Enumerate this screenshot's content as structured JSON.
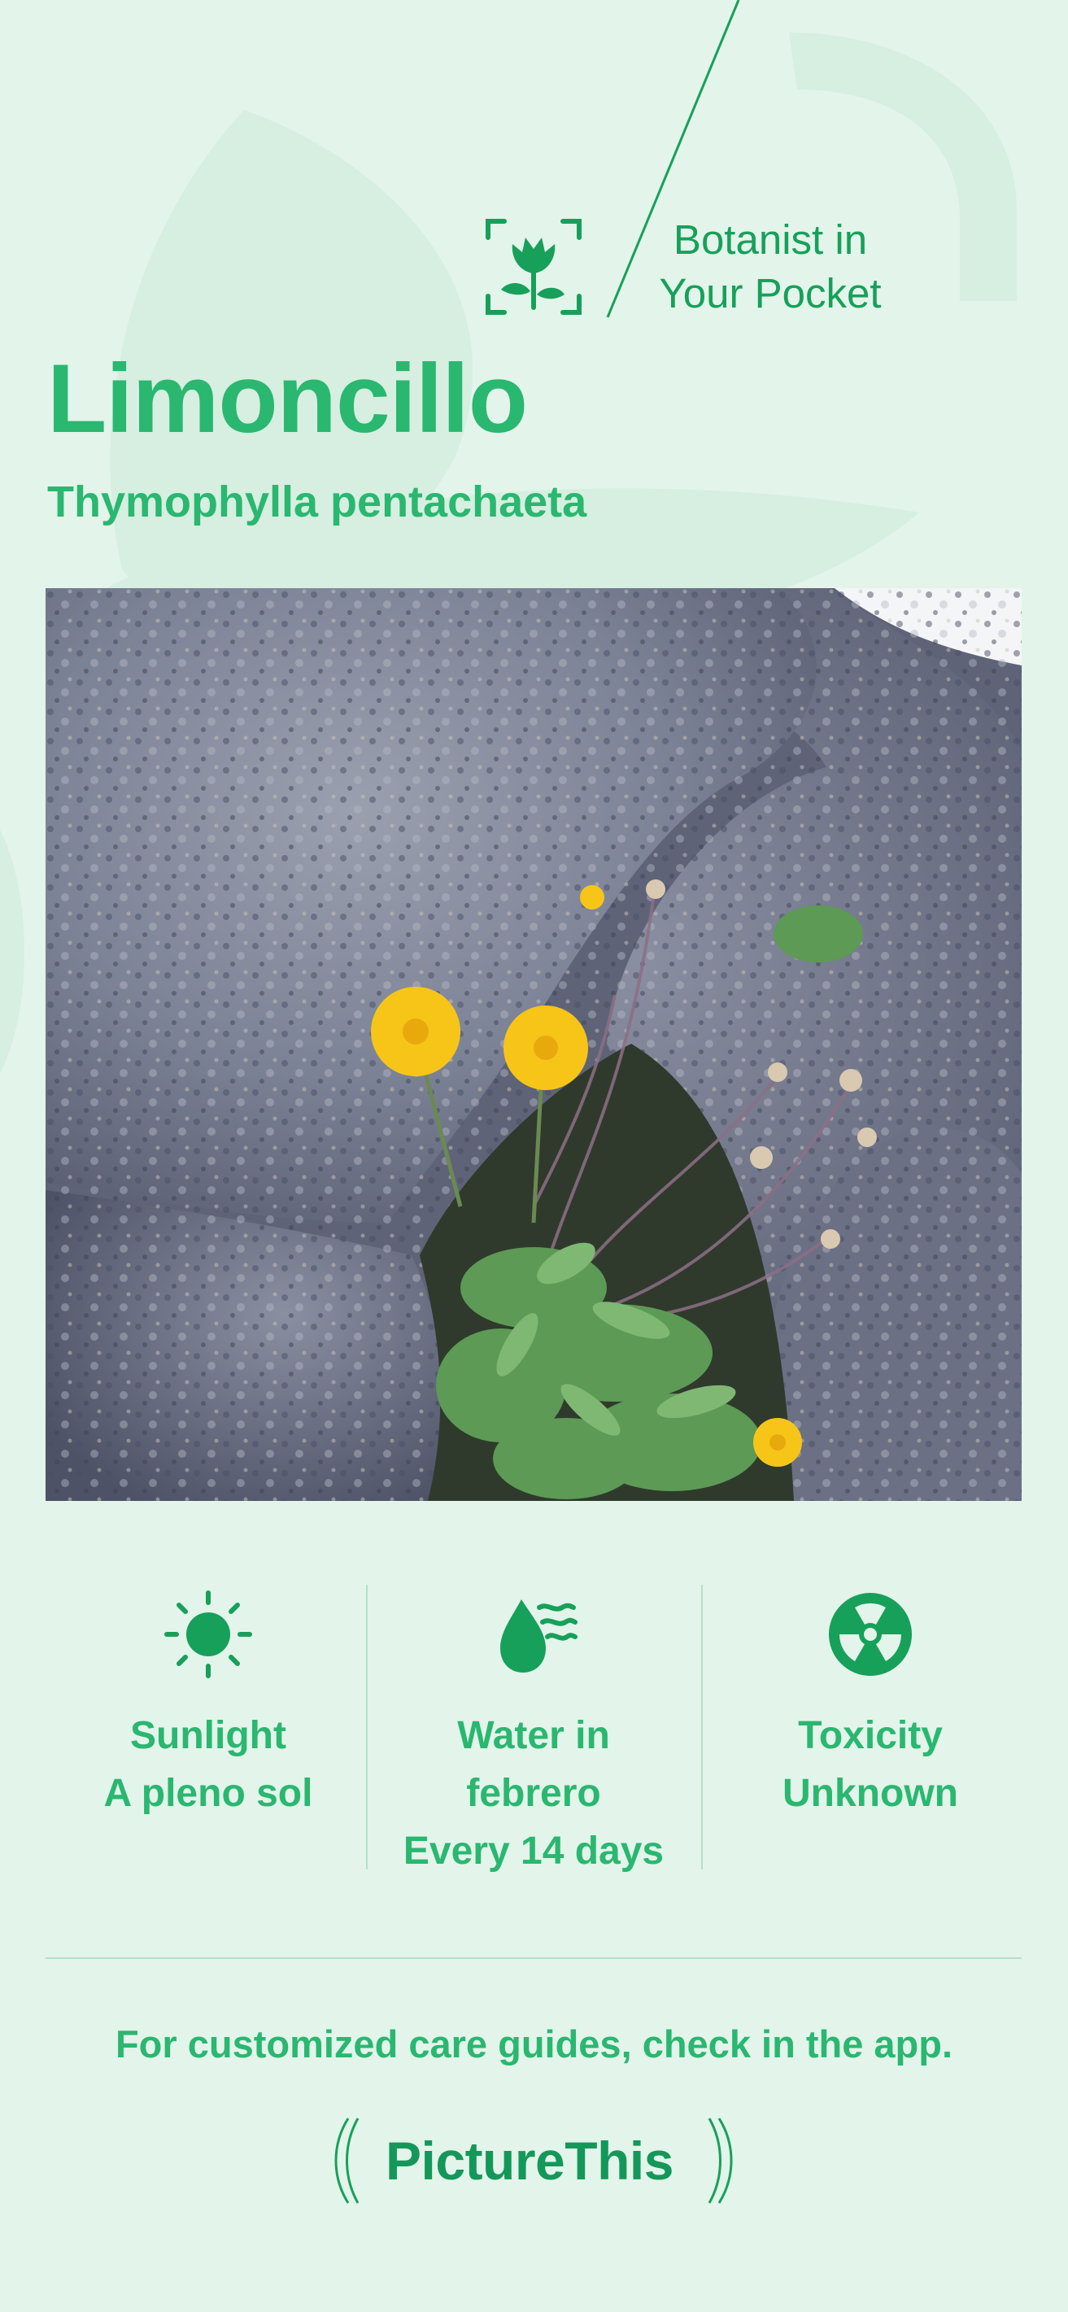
{
  "brand": {
    "tagline_line1": "Botanist in",
    "tagline_line2": "Your Pocket",
    "logo_text": "PictureThis"
  },
  "plant": {
    "common_name": "Limoncillo",
    "scientific_name": "Thymophylla pentachaeta"
  },
  "care": [
    {
      "icon": "sun-icon",
      "lines": [
        "Sunlight",
        "A pleno sol"
      ]
    },
    {
      "icon": "water-drop-icon",
      "lines": [
        "Water in",
        "febrero",
        "Every 14 days"
      ]
    },
    {
      "icon": "radiation-icon",
      "lines": [
        "Toxicity",
        "Unknown"
      ]
    }
  ],
  "footer": {
    "note": "For customized care guides, check in the app."
  },
  "colors": {
    "background": "#e3f4ea",
    "accent": "#2ab770",
    "brand_green": "#17a05a",
    "divider": "#b5e0c8"
  }
}
